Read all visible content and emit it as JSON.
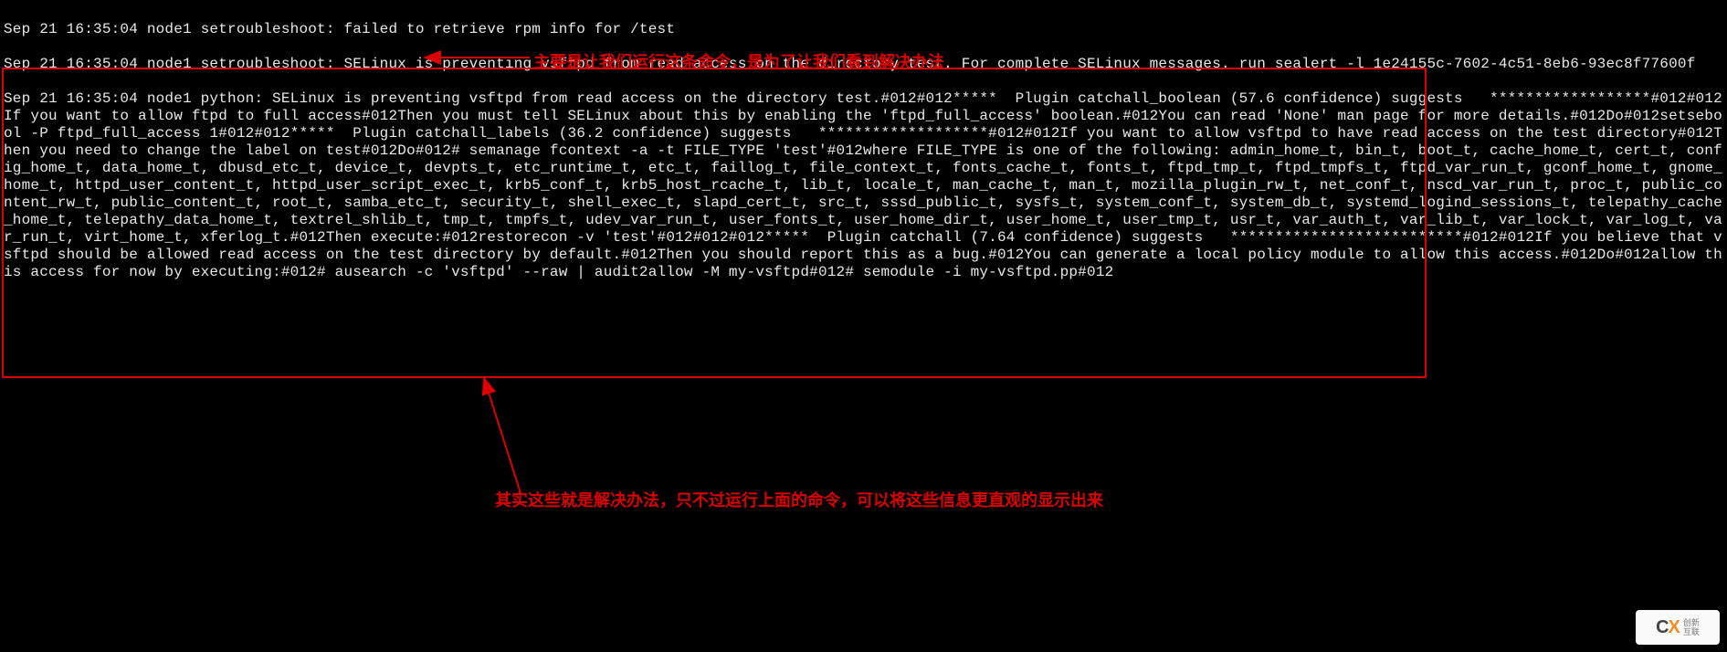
{
  "log": {
    "lines": [
      "Sep 21 16:35:04 node1 setroubleshoot: failed to retrieve rpm info for /test",
      "Sep 21 16:35:04 node1 setroubleshoot: SELinux is preventing vsftpd from read access on the directory test. For complete SELinux messages. run sealert -l 1e24155c-7602-4c51-8eb6-93ec8f77600f",
      "Sep 21 16:35:04 node1 python: SELinux is preventing vsftpd from read access on the directory test.#012#012*****  Plugin catchall_boolean (57.6 confidence) suggests   ******************#012#012If you want to allow ftpd to full access#012Then you must tell SELinux about this by enabling the 'ftpd_full_access' boolean.#012You can read 'None' man page for more details.#012Do#012setsebool -P ftpd_full_access 1#012#012*****  Plugin catchall_labels (36.2 confidence) suggests   *******************#012#012If you want to allow vsftpd to have read access on the test directory#012Then you need to change the label on test#012Do#012# semanage fcontext -a -t FILE_TYPE 'test'#012where FILE_TYPE is one of the following: admin_home_t, bin_t, boot_t, cache_home_t, cert_t, config_home_t, data_home_t, dbusd_etc_t, device_t, devpts_t, etc_runtime_t, etc_t, faillog_t, file_context_t, fonts_cache_t, fonts_t, ftpd_tmp_t, ftpd_tmpfs_t, ftpd_var_run_t, gconf_home_t, gnome_home_t, httpd_user_content_t, httpd_user_script_exec_t, krb5_conf_t, krb5_host_rcache_t, lib_t, locale_t, man_cache_t, man_t, mozilla_plugin_rw_t, net_conf_t, nscd_var_run_t, proc_t, public_content_rw_t, public_content_t, root_t, samba_etc_t, security_t, shell_exec_t, slapd_cert_t, src_t, sssd_public_t, sysfs_t, system_conf_t, system_db_t, systemd_logind_sessions_t, telepathy_cache_home_t, telepathy_data_home_t, textrel_shlib_t, tmp_t, tmpfs_t, udev_var_run_t, user_fonts_t, user_home_dir_t, user_home_t, user_tmp_t, usr_t, var_auth_t, var_lib_t, var_lock_t, var_log_t, var_run_t, virt_home_t, xferlog_t.#012Then execute:#012restorecon -v 'test'#012#012#012*****  Plugin catchall (7.64 confidence) suggests   **************************#012#012If you believe that vsftpd should be allowed read access on the test directory by default.#012Then you should report this as a bug.#012You can generate a local policy module to allow this access.#012Do#012allow this access for now by executing:#012# ausearch -c 'vsftpd' --raw | audit2allow -M my-vsftpd#012# semodule -i my-vsftpd.pp#012"
    ]
  },
  "annotations": {
    "top": "主要是让我们运行这条命令，是为了让我们看到解决办法",
    "bottom": "其实这些就是解决办法，只不过运行上面的命令，可以将这些信息更直观的显示出来"
  },
  "watermark": {
    "brand_prefix": "C",
    "brand_accent": "X",
    "sub1": "创新",
    "sub2": "互联"
  }
}
